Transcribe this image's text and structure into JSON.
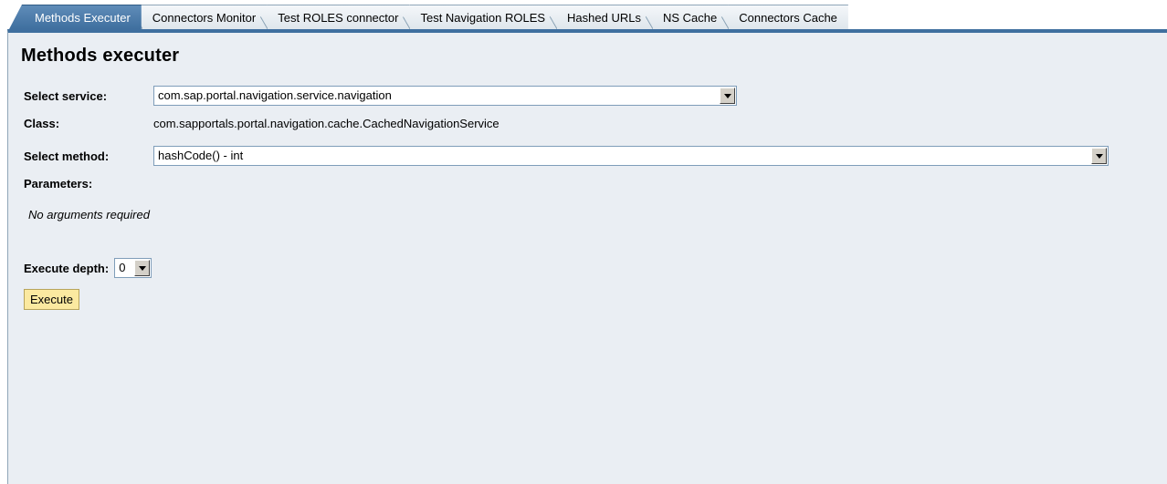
{
  "tabs": [
    {
      "label": "Methods Executer",
      "active": true
    },
    {
      "label": "Connectors Monitor"
    },
    {
      "label": "Test ROLES connector"
    },
    {
      "label": "Test Navigation ROLES"
    },
    {
      "label": "Hashed URLs"
    },
    {
      "label": "NS Cache"
    },
    {
      "label": "Connectors Cache"
    }
  ],
  "page_title": "Methods executer",
  "service": {
    "label": "Select service:",
    "value": "com.sap.portal.navigation.service.navigation"
  },
  "class": {
    "label": "Class:",
    "value": "com.sapportals.portal.navigation.cache.CachedNavigationService"
  },
  "method": {
    "label": "Select method:",
    "value": "hashCode() - int"
  },
  "parameters": {
    "label": "Parameters:",
    "note": "No arguments required"
  },
  "depth": {
    "label": "Execute depth:",
    "value": "0"
  },
  "execute_label": "Execute",
  "colors": {
    "tab_active": "#3f6f9f",
    "panel_bg": "#eaeef3",
    "button_bg": "#fbe9a0"
  }
}
